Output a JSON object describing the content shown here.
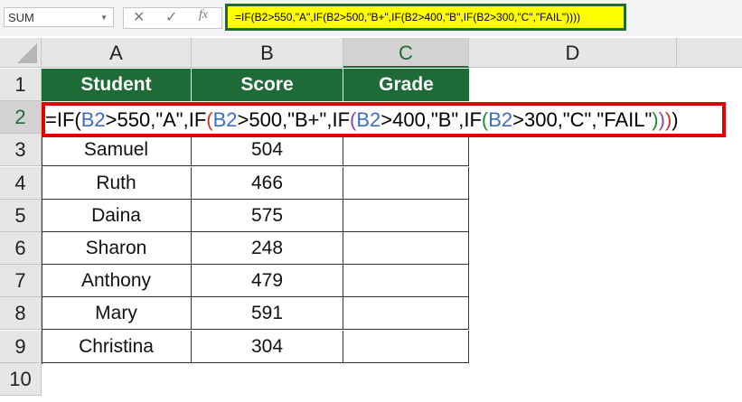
{
  "name_box": "SUM",
  "formula_bar": {
    "cancel_icon": "x-icon",
    "enter_icon": "check-icon",
    "fx_label": "fx",
    "value": "=IF(B2>550,\"A\",IF(B2>500,\"B+\",IF(B2>400,\"B\",IF(B2>300,\"C\",\"FAIL\"))))"
  },
  "columns": [
    "A",
    "B",
    "C",
    "D"
  ],
  "rows": [
    "1",
    "2",
    "3",
    "4",
    "5",
    "6",
    "7",
    "8",
    "9",
    "10"
  ],
  "headers": {
    "student": "Student",
    "score": "Score",
    "grade": "Grade"
  },
  "cell_formula_parts": [
    "=IF(",
    "B2",
    ">550,\"A\",IF",
    "(",
    "B2",
    ">500,\"B+\",IF",
    "(",
    "B2",
    ">400,\"B\",IF",
    "(",
    "B2",
    ">300,\"C\",\"FAIL\"",
    ")",
    ")",
    ")",
    ")"
  ],
  "data": [
    {
      "student": "Samuel",
      "score": "504"
    },
    {
      "student": "Ruth",
      "score": "466"
    },
    {
      "student": "Daina",
      "score": "575"
    },
    {
      "student": "Sharon",
      "score": "248"
    },
    {
      "student": "Anthony",
      "score": "479"
    },
    {
      "student": "Mary",
      "score": "591"
    },
    {
      "student": "Christina",
      "score": "304"
    }
  ],
  "colors": {
    "header_green": "#1e6b37",
    "highlight": "#ffff00",
    "outline_red": "#e00000"
  }
}
